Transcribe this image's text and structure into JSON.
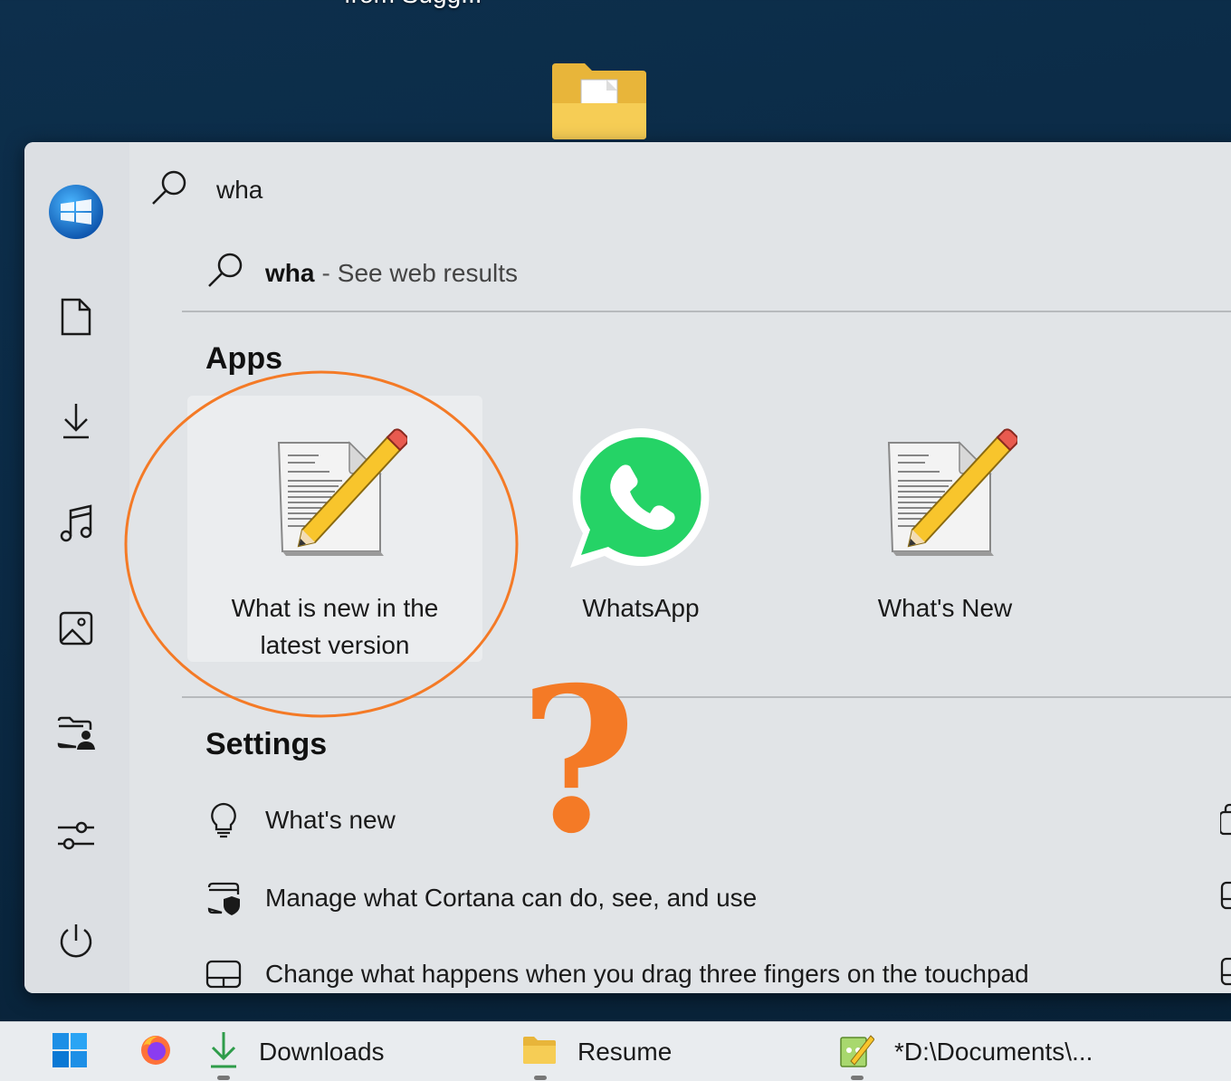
{
  "desktop": {
    "folder_label": "from Sugg..."
  },
  "search": {
    "query": "wha"
  },
  "web_result": {
    "query": "wha",
    "separator": "-",
    "hint": "See web results"
  },
  "sections": {
    "apps_title": "Apps",
    "settings_title": "Settings"
  },
  "apps": [
    {
      "label_line1": "What is new in the",
      "label_line2": "latest version",
      "icon": "notepad-plus-plus-icon",
      "selected": true
    },
    {
      "label": "WhatsApp",
      "icon": "whatsapp-icon"
    },
    {
      "label": "What's New",
      "icon": "notepad-plus-plus-icon"
    }
  ],
  "settings": [
    {
      "label": "What's new",
      "icon": "lightbulb-icon"
    },
    {
      "label": "Manage what Cortana can do, see, and use",
      "icon": "shield-window-icon"
    },
    {
      "label": "Change what happens when you drag three fingers on the touchpad",
      "icon": "touchpad-icon"
    }
  ],
  "rail": [
    "user-avatar",
    "documents-icon",
    "downloads-icon",
    "music-icon",
    "pictures-icon",
    "personal-folder-icon",
    "settings-sliders-icon",
    "power-icon"
  ],
  "annotation": {
    "mark": "?",
    "color": "#f47a26"
  },
  "taskbar": {
    "items": [
      {
        "label": "Downloads",
        "icon": "download-arrow-icon"
      },
      {
        "label": "Resume",
        "icon": "folder-icon"
      },
      {
        "label": "*D:\\Documents\\...",
        "icon": "notepad-plus-plus-icon"
      }
    ]
  },
  "colors": {
    "accent_orange": "#f47a26",
    "whatsapp_green": "#25d366",
    "windows_blue": "#0a78d4"
  }
}
